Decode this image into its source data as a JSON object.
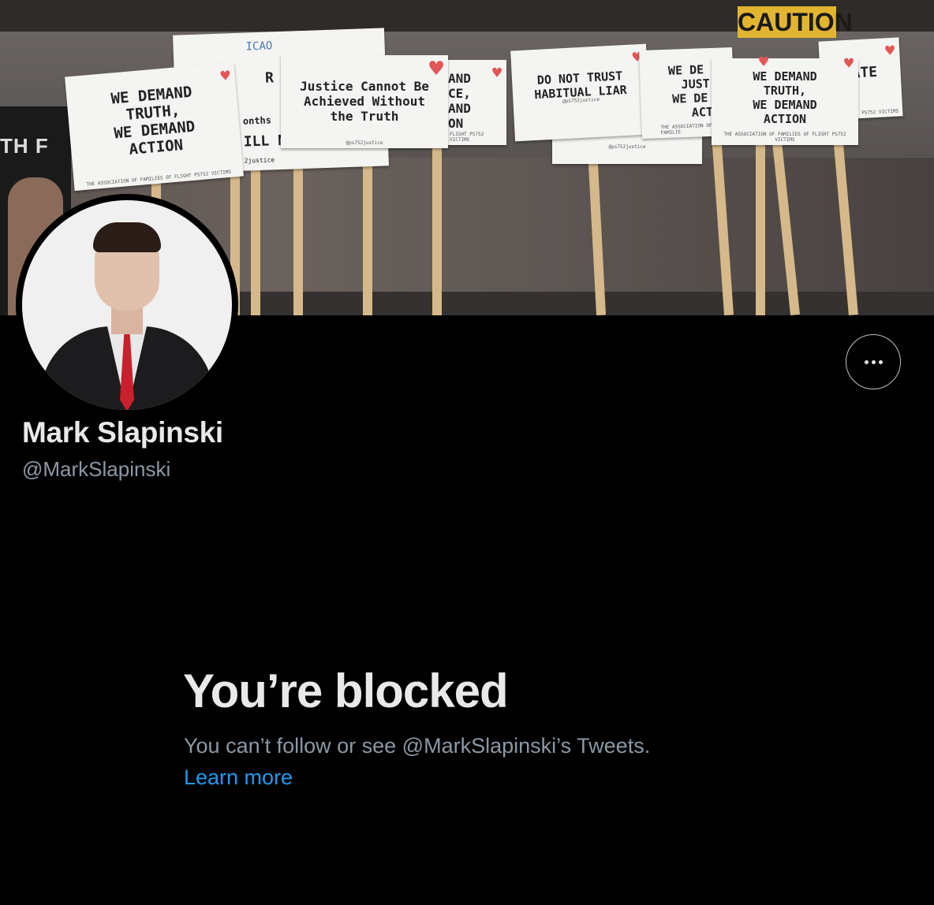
{
  "profile": {
    "name": "Mark Slapinski",
    "handle": "@MarkSlapinski"
  },
  "banner": {
    "poster_text": "TH F",
    "caution_text": "CAUTION",
    "signs": {
      "s1": [
        "WE DEMAND",
        "TRUTH,",
        "WE DEMAND",
        "ACTION"
      ],
      "s1_foot": "THE ASSOCIATION OF FAMILIES OF FLIGHT PS752 VICTIMS",
      "s2_top": "ICAO",
      "s2": "R",
      "s2_lines": [
        "onths",
        "ILL N"
      ],
      "s2_foot": "2justice",
      "s3": [
        "Justice Cannot Be",
        "Achieved Without",
        "the Truth"
      ],
      "s3_foot": "@ps752justice",
      "s4": [
        "AND",
        "CE,",
        "AND",
        "ON"
      ],
      "s4_foot": "FLIGHT PS752 VICTIMS",
      "s5": [
        "DO NOT TRUST",
        "HABITUAL LIAR"
      ],
      "s5_foot": "@ps752justice",
      "s5b_foot": "@ps752justice",
      "s6": [
        "WE DE",
        "JUST",
        "WE DE",
        "ACT"
      ],
      "s6_foot": "THE ASSOCIATION OF FAMILIE",
      "s7": [
        "WE DEMAND",
        "TRUTH,",
        "WE DEMAND",
        "ACTION"
      ],
      "s7_foot": "THE ASSOCIATION OF FAMILIES OF FLIGHT PS752 VICTIMS",
      "s8": "ATE",
      "s8_foot": "PS752 VICTIMS"
    }
  },
  "actions": {
    "more_icon": "ellipsis-icon"
  },
  "blocked": {
    "title": "You’re blocked",
    "description": "You can’t follow or see @MarkSlapinski’s Tweets.",
    "learn_more": "Learn more"
  },
  "colors": {
    "background": "#000000",
    "text_primary": "#e7e9ea",
    "text_secondary": "#8b98a5",
    "link": "#1d9bf0"
  }
}
